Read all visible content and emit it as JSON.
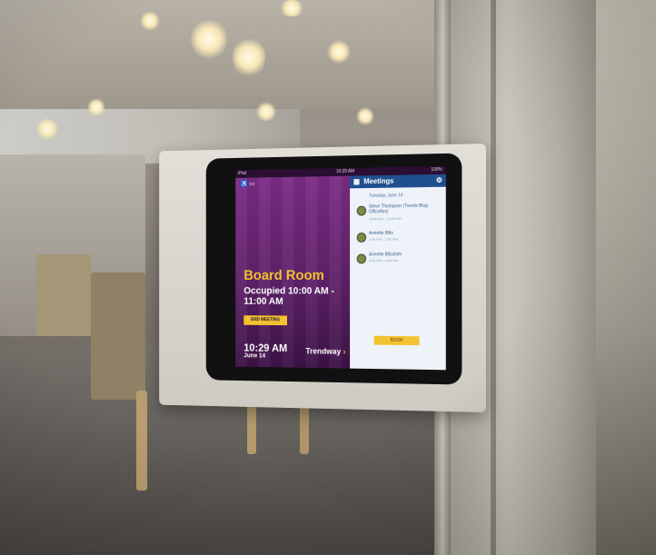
{
  "scene": {
    "description_colors": {
      "screen_purple": "#7b2d85",
      "accent_yellow": "#f2c230",
      "header_blue": "#1f4f8f"
    }
  },
  "status_bar": {
    "carrier": "iPad",
    "clock": "10:29 AM",
    "battery": "100%"
  },
  "room_panel": {
    "room_name": "Board Room",
    "status": "Occupied 10:00 AM - 11:00 AM",
    "end_meeting_label": "END MEETING",
    "time": "10:29 AM",
    "date": "June 14",
    "brand": "Trendway"
  },
  "meetings_panel": {
    "title": "Meetings",
    "date_heading": "Tuesday, June 14",
    "items": [
      {
        "title": "Steve Thompson (Trends Blog Officeflex)",
        "time": "10:00 AM - 11:00 AM"
      },
      {
        "title": "Annette Blits",
        "time": "1:00 PM - 2:00 PM"
      },
      {
        "title": "Annette Blits/Info",
        "time": "3:00 PM - 4:00 PM"
      }
    ],
    "book_label": "BOOK"
  },
  "icons": {
    "settings": "gear-icon",
    "calendar": "calendar-icon",
    "brand_chevron": "chevron-right-icon"
  }
}
